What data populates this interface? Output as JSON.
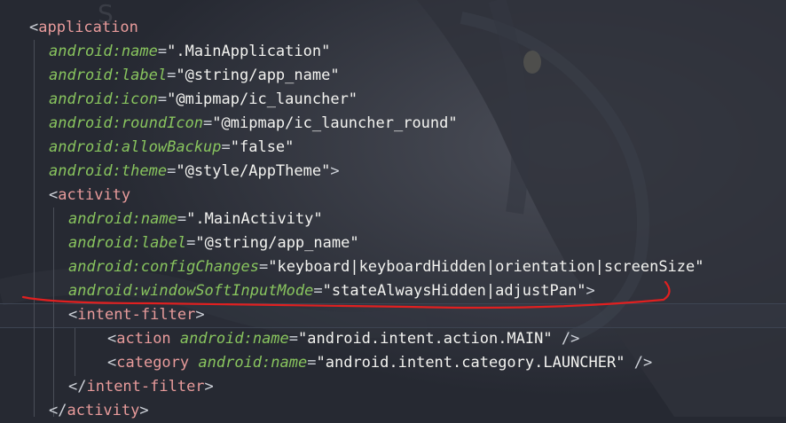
{
  "editor": {
    "lines": [
      {
        "indent": 0,
        "tag_open": "<",
        "tag": "application",
        "tag_close": ""
      },
      {
        "indent": 1,
        "prefix": "android",
        "sep": ":",
        "attr": "name",
        "eq": "=",
        "value": "\".MainApplication\""
      },
      {
        "indent": 1,
        "prefix": "android",
        "sep": ":",
        "attr": "label",
        "eq": "=",
        "value": "\"@string/app_name\""
      },
      {
        "indent": 1,
        "prefix": "android",
        "sep": ":",
        "attr": "icon",
        "eq": "=",
        "value": "\"@mipmap/ic_launcher\""
      },
      {
        "indent": 1,
        "prefix": "android",
        "sep": ":",
        "attr": "roundIcon",
        "eq": "=",
        "value": "\"@mipmap/ic_launcher_round\""
      },
      {
        "indent": 1,
        "prefix": "android",
        "sep": ":",
        "attr": "allowBackup",
        "eq": "=",
        "value": "\"false\""
      },
      {
        "indent": 1,
        "prefix": "android",
        "sep": ":",
        "attr": "theme",
        "eq": "=",
        "value": "\"@style/AppTheme\"",
        "tail": ">"
      },
      {
        "indent": 1,
        "tag_open": "<",
        "tag": "activity",
        "tag_close": ""
      },
      {
        "indent": 2,
        "prefix": "android",
        "sep": ":",
        "attr": "name",
        "eq": "=",
        "value": "\".MainActivity\""
      },
      {
        "indent": 2,
        "prefix": "android",
        "sep": ":",
        "attr": "label",
        "eq": "=",
        "value": "\"@string/app_name\""
      },
      {
        "indent": 2,
        "prefix": "android",
        "sep": ":",
        "attr": "configChanges",
        "eq": "=",
        "value": "\"keyboard|keyboardHidden|orientation|screenSize\""
      },
      {
        "indent": 2,
        "prefix": "android",
        "sep": ":",
        "attr": "windowSoftInputMode",
        "eq": "=",
        "value": "\"stateAlwaysHidden|adjustPan\"",
        "tail": ">"
      },
      {
        "indent": 2,
        "tag_open": "<",
        "tag": "intent-filter",
        "tag_close": ">"
      },
      {
        "indent": 3,
        "tag_open": "<",
        "tag": "action",
        "space": " ",
        "prefix": "android",
        "sep": ":",
        "attr": "name",
        "eq": "=",
        "value": "\"android.intent.action.MAIN\"",
        "tail": " />"
      },
      {
        "indent": 3,
        "tag_open": "<",
        "tag": "category",
        "space": " ",
        "prefix": "android",
        "sep": ":",
        "attr": "name",
        "eq": "=",
        "value": "\"android.intent.category.LAUNCHER\"",
        "tail": " />"
      },
      {
        "indent": 2,
        "tag_open": "</",
        "tag": "intent-filter",
        "tag_close": ">"
      },
      {
        "indent": 1,
        "tag_open": "</",
        "tag": "activity",
        "tag_close": ">"
      }
    ]
  },
  "colors": {
    "background": "#262932",
    "tag": "#e89b9b",
    "attribute": "#88c45e",
    "string": "#f3f3f0",
    "annotation": "#e02020"
  }
}
